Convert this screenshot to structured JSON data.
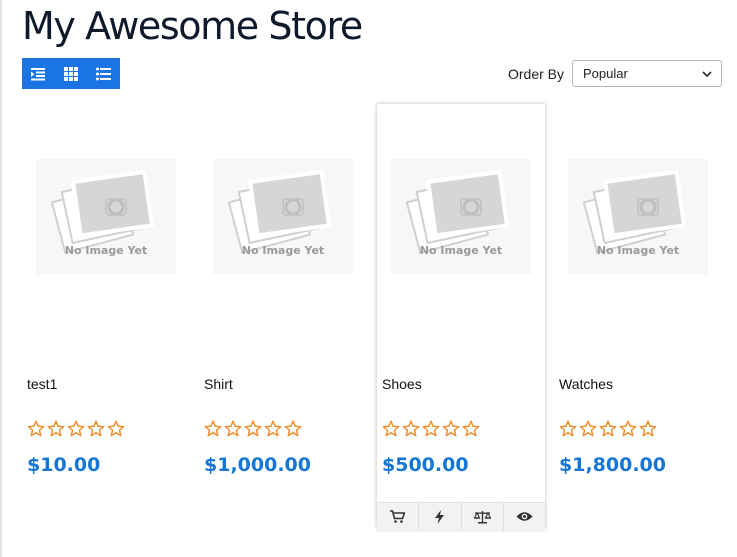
{
  "store": {
    "title": "My Awesome Store"
  },
  "toolbar": {
    "view_icons": [
      "indent-list-icon",
      "grid-icon",
      "list-icon"
    ],
    "order_label": "Order By",
    "order_value": "Popular",
    "accent": "#1b74e4"
  },
  "products": [
    {
      "image_text": "No Image Yet",
      "name": "test1",
      "rating": 0,
      "price": "$10.00"
    },
    {
      "image_text": "No Image Yet",
      "name": "Shirt",
      "rating": 0,
      "price": "$1,000.00"
    },
    {
      "image_text": "No Image Yet",
      "name": "Shoes",
      "rating": 0,
      "price": "$500.00"
    },
    {
      "image_text": "No Image Yet",
      "name": "Watches",
      "rating": 0,
      "price": "$1,800.00"
    }
  ],
  "card_actions": [
    "cart-icon",
    "bolt-icon",
    "compare-scale-icon",
    "eye-icon"
  ],
  "colors": {
    "price": "#1676d6",
    "star": "#f08a24"
  }
}
